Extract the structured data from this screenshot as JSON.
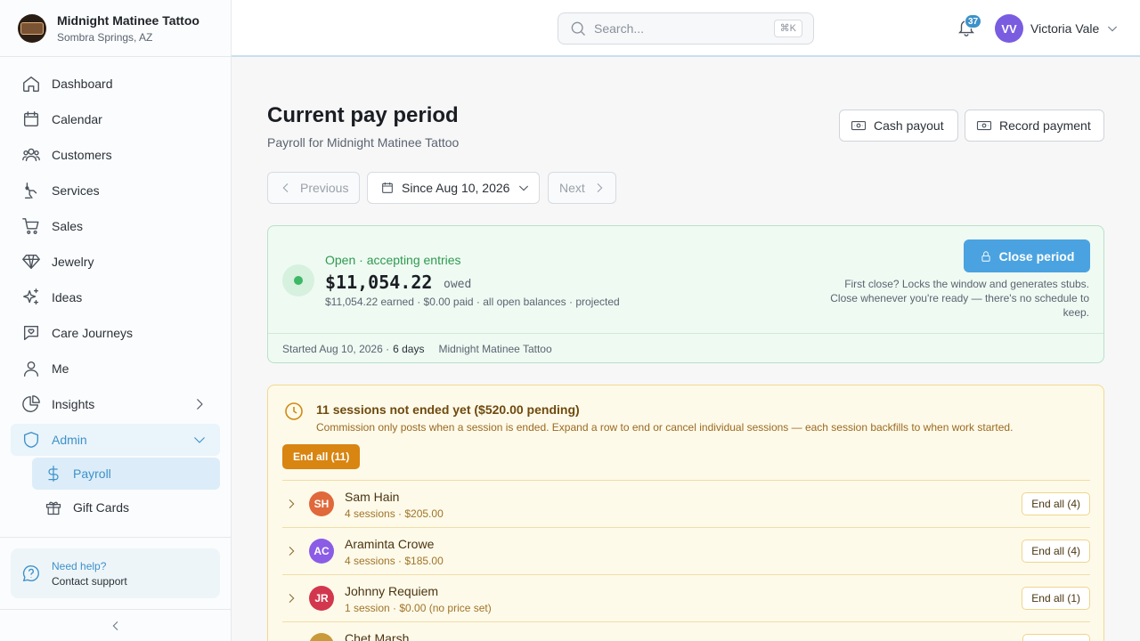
{
  "brand": {
    "name": "Midnight Matinee Tattoo",
    "location": "Sombra Springs, AZ"
  },
  "nav": {
    "items": [
      {
        "label": "Dashboard",
        "icon": "home-icon"
      },
      {
        "label": "Calendar",
        "icon": "calendar-icon"
      },
      {
        "label": "Customers",
        "icon": "users-icon"
      },
      {
        "label": "Services",
        "icon": "tattoo-machine-icon"
      },
      {
        "label": "Sales",
        "icon": "cart-icon"
      },
      {
        "label": "Jewelry",
        "icon": "gem-icon"
      },
      {
        "label": "Ideas",
        "icon": "sparkles-icon"
      },
      {
        "label": "Care Journeys",
        "icon": "heart-chat-icon"
      },
      {
        "label": "Me",
        "icon": "user-icon"
      },
      {
        "label": "Insights",
        "icon": "pie-chart-icon"
      }
    ],
    "admin": {
      "label": "Admin",
      "icon": "shield-icon"
    },
    "sub": [
      {
        "label": "Payroll",
        "icon": "dollar-icon"
      },
      {
        "label": "Gift Cards",
        "icon": "gift-icon"
      }
    ]
  },
  "help": {
    "title": "Need help?",
    "subtitle": "Contact support"
  },
  "topbar": {
    "search_placeholder": "Search...",
    "search_shortcut": "⌘K",
    "notifications": "37",
    "user_initials": "VV",
    "user_name": "Victoria Vale"
  },
  "page": {
    "title": "Current pay period",
    "subtitle": "Payroll for Midnight Matinee Tattoo",
    "cash_payout": "Cash payout",
    "record_payment": "Record payment",
    "prev": "Previous",
    "period": "Since Aug 10, 2026",
    "next": "Next"
  },
  "status": {
    "label": "Open · accepting entries",
    "amount": "$11,054.22",
    "owed": "owed",
    "detail": "$11,054.22 earned · $0.00 paid · all open balances · projected",
    "close_button": "Close period",
    "note": "First close? Locks the window and generates stubs. Close whenever you're ready — there's no schedule to keep.",
    "started": "Started Aug 10, 2026 ·",
    "days": "6 days",
    "shop": "Midnight Matinee Tattoo",
    "accent": "#3db864"
  },
  "sessions": {
    "title": "11 sessions not ended yet ($520.00 pending)",
    "description": "Commission only posts when a session is ended. Expand a row to end or cancel individual sessions — each session backfills to when work started.",
    "end_all": "End all (11)",
    "rows": [
      {
        "initials": "SH",
        "name": "Sam Hain",
        "meta": "4 sessions · $205.00",
        "button": "End all (4)",
        "color": "#e0683a"
      },
      {
        "initials": "AC",
        "name": "Araminta Crowe",
        "meta": "4 sessions · $185.00",
        "button": "End all (4)",
        "color": "#8b5ce6"
      },
      {
        "initials": "JR",
        "name": "Johnny Requiem",
        "meta": "1 session · $0.00 (no price set)",
        "button": "End all (1)",
        "color": "#d2374e"
      },
      {
        "initials": "",
        "name": "Chet Marsh",
        "meta": "",
        "button": "",
        "color": "#c99a3a"
      }
    ]
  }
}
